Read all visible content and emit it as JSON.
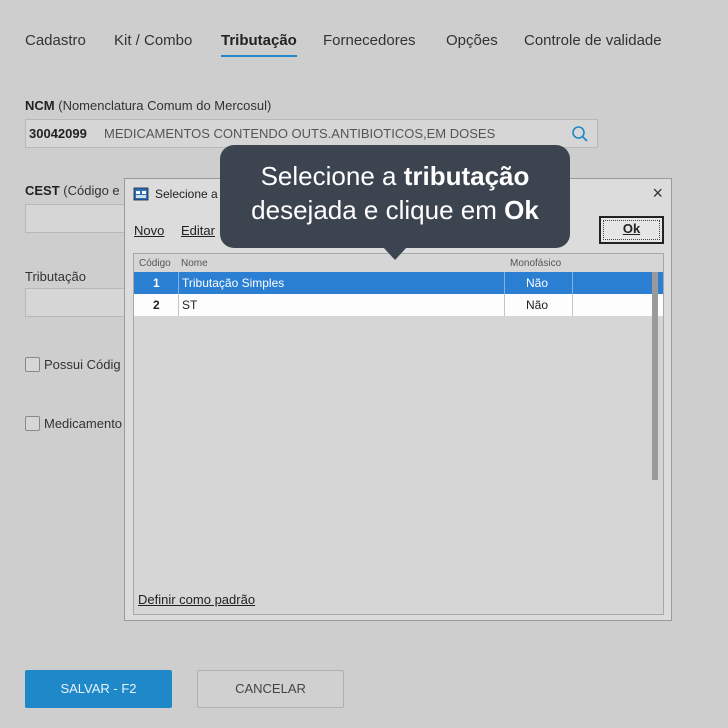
{
  "tabs": [
    "Cadastro",
    "Kit / Combo",
    "Tributação",
    "Fornecedores",
    "Opções",
    "Controle de validade"
  ],
  "active_tab": "Tributação",
  "ncm": {
    "label_bold": "NCM",
    "label_rest": "(Nomenclatura Comum do Mercosul)",
    "code": "30042099",
    "description": "MEDICAMENTOS CONTENDO OUTS.ANTIBIOTICOS,EM DOSES"
  },
  "cest": {
    "label_bold": "CEST",
    "label_rest": "(Código e"
  },
  "tributacao_label": "Tributação",
  "checkbox_possui": "Possui Códig",
  "checkbox_medicamento": "Medicamento",
  "buttons": {
    "save": "SALVAR - F2",
    "cancel": "CANCELAR"
  },
  "dialog": {
    "title": "Selecione a t",
    "close": "×",
    "menu": {
      "novo": "Novo",
      "editar": "Editar"
    },
    "ok": "Ok",
    "columns": {
      "codigo": "Código",
      "nome": "Nome",
      "monofasico": "Monofásico"
    },
    "rows": [
      {
        "codigo": "1",
        "nome": "Tributação Simples",
        "monofasico": "Não",
        "selected": true
      },
      {
        "codigo": "2",
        "nome": "ST",
        "monofasico": "Não",
        "selected": false
      }
    ],
    "definir_padrao": "Definir como padrão"
  },
  "tooltip": {
    "line1_pre": "Selecione a ",
    "line1_bold": "tributação",
    "line2_pre": "desejada e clique em ",
    "line2_bold": "Ok"
  },
  "colors": {
    "accent": "#1e88c8",
    "selection": "#2a7fd3",
    "tooltip_bg": "#3c4450"
  }
}
